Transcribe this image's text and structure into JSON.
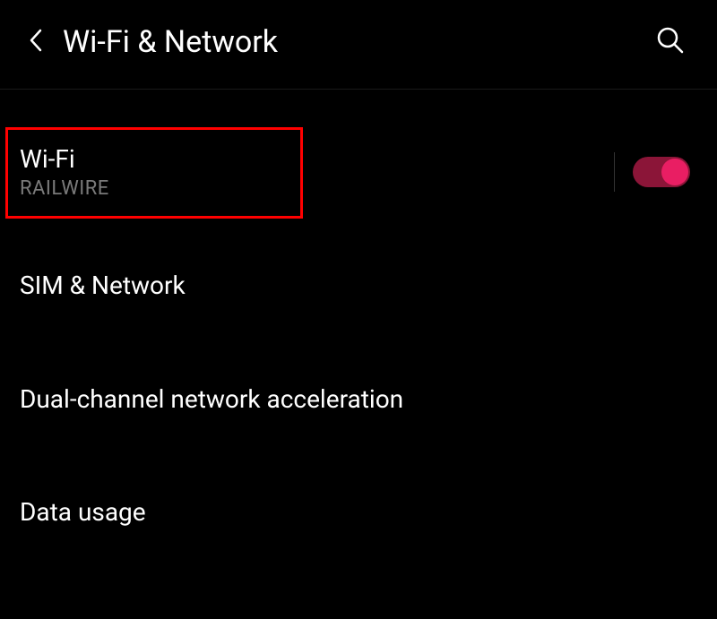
{
  "header": {
    "title": "Wi-Fi & Network"
  },
  "items": [
    {
      "title": "Wi-Fi",
      "subtitle": "RAILWIRE",
      "hasToggle": true,
      "toggleOn": true,
      "highlighted": true
    },
    {
      "title": "SIM & Network"
    },
    {
      "title": "Dual-channel network acceleration"
    },
    {
      "title": "Data usage"
    }
  ]
}
